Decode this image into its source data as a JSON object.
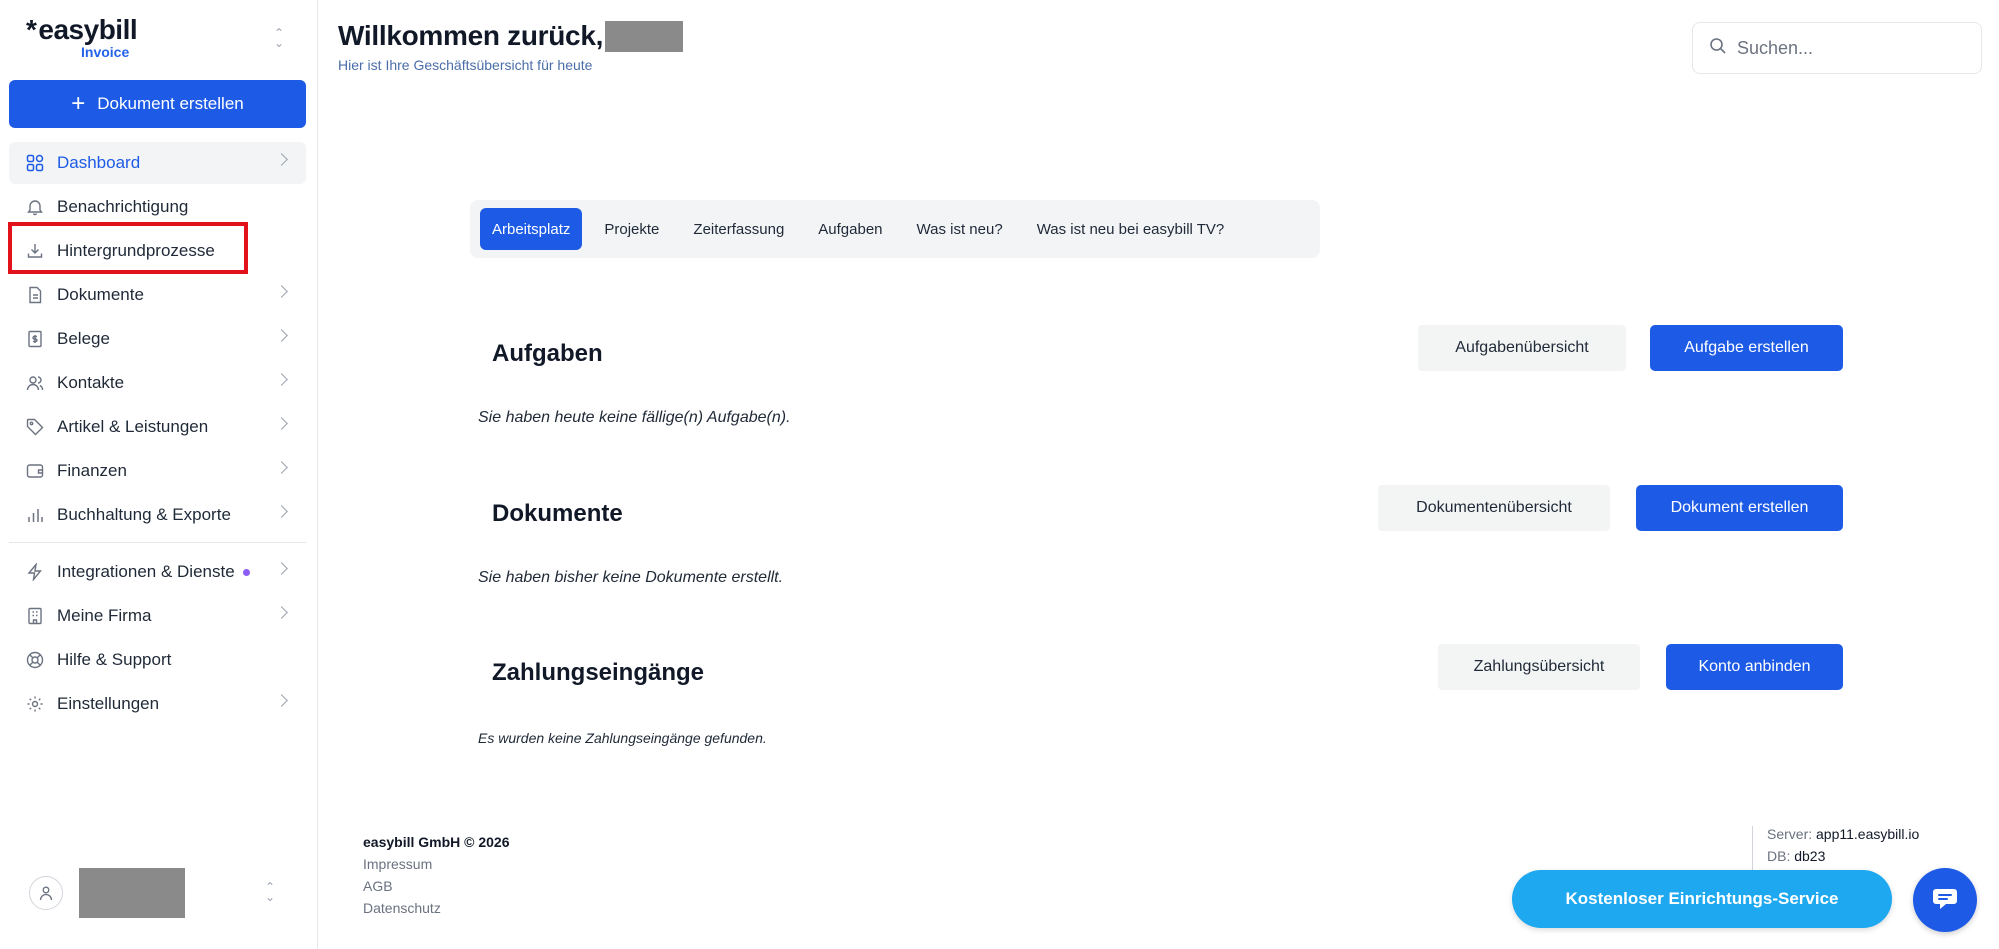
{
  "brand": {
    "logo": "easybill",
    "product": "Invoice"
  },
  "sidebar": {
    "create_label": "Dokument erstellen",
    "items": [
      {
        "label": "Dashboard",
        "icon": "grid-icon",
        "active": true,
        "chevron": true
      },
      {
        "label": "Benachrichtigung",
        "icon": "bell-icon",
        "chevron": false
      },
      {
        "label": "Hintergrundprozesse",
        "icon": "download-icon",
        "chevron": false
      },
      {
        "label": "Dokumente",
        "icon": "document-icon",
        "chevron": true
      },
      {
        "label": "Belege",
        "icon": "receipt-icon",
        "chevron": true
      },
      {
        "label": "Kontakte",
        "icon": "users-icon",
        "chevron": true
      },
      {
        "label": "Artikel & Leistungen",
        "icon": "tag-icon",
        "chevron": true
      },
      {
        "label": "Finanzen",
        "icon": "wallet-icon",
        "chevron": true
      },
      {
        "label": "Buchhaltung & Exporte",
        "icon": "bar-chart-icon",
        "chevron": true
      },
      {
        "label": "Integrationen & Dienste",
        "icon": "lightning-icon",
        "chevron": true,
        "dot": true
      },
      {
        "label": "Meine Firma",
        "icon": "building-icon",
        "chevron": true
      },
      {
        "label": "Hilfe & Support",
        "icon": "lifebuoy-icon",
        "chevron": false
      },
      {
        "label": "Einstellungen",
        "icon": "gear-icon",
        "chevron": true
      }
    ]
  },
  "header": {
    "welcome": "Willkommen zurück,",
    "subtitle": "Hier ist Ihre Geschäftsübersicht für heute",
    "search_placeholder": "Suchen..."
  },
  "tabs": [
    {
      "label": "Arbeitsplatz",
      "active": true
    },
    {
      "label": "Projekte"
    },
    {
      "label": "Zeiterfassung"
    },
    {
      "label": "Aufgaben"
    },
    {
      "label": "Was ist neu?"
    },
    {
      "label": "Was ist neu bei easybill TV?"
    }
  ],
  "sections": {
    "tasks": {
      "title": "Aufgaben",
      "overview_label": "Aufgabenübersicht",
      "create_label": "Aufgabe erstellen",
      "empty": "Sie haben heute keine fällige(n) Aufgabe(n)."
    },
    "documents": {
      "title": "Dokumente",
      "overview_label": "Dokumentenübersicht",
      "create_label": "Dokument erstellen",
      "empty": "Sie haben bisher keine Dokumente erstellt."
    },
    "payments": {
      "title": "Zahlungseingänge",
      "overview_label": "Zahlungsübersicht",
      "create_label": "Konto anbinden",
      "empty": "Es wurden keine Zahlungseingänge gefunden."
    }
  },
  "footer": {
    "company": "easybill GmbH © 2026",
    "links": [
      "Impressum",
      "AGB",
      "Datenschutz"
    ],
    "server_label": "Server:",
    "server_value": "app11.easybill.io",
    "db_label": "DB:",
    "db_value": "db23"
  },
  "setup_button": "Kostenloser Einrichtungs-Service",
  "colors": {
    "primary": "#1d5be6",
    "accent_light": "#1da8f0",
    "highlight": "#e3121a",
    "dot": "#8b5cf6"
  }
}
